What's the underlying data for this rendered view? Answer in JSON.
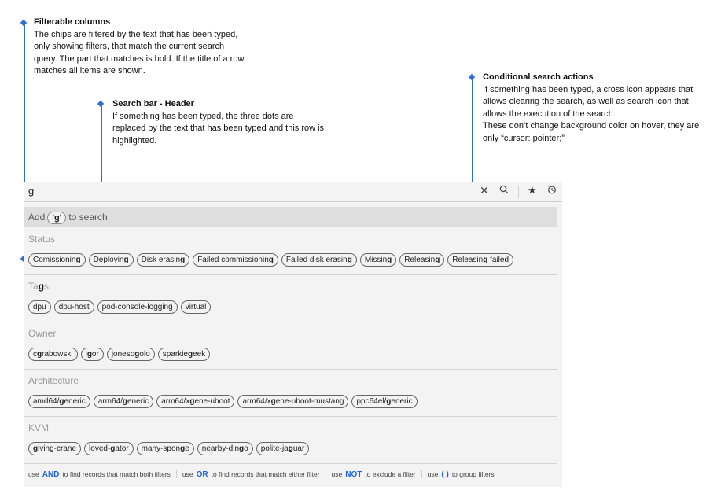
{
  "annotations": {
    "filterable": {
      "title": "Filterable columns",
      "lines": [
        "The chips are filtered by the text that has been typed,",
        "only showing filters, that match the current search",
        "query. The part that matches is bold. If the title of a row",
        "matches all items are shown."
      ]
    },
    "searchbar": {
      "title": "Search bar - Header",
      "lines": [
        "If something has been typed, the three dots are",
        "replaced by the text that has been typed and this row is",
        "highlighted."
      ]
    },
    "conditional": {
      "title": "Conditional search actions",
      "lines": [
        "If something has been typed, a cross icon appears that",
        "allows clearing the search, as well as search icon that",
        "allows the execution of the search.",
        "These don’t change background color on hover, they are",
        "only “cursor: pointer;”"
      ]
    }
  },
  "search": {
    "query": "g",
    "icons": [
      "close-icon",
      "search-icon",
      "star-icon",
      "history-icon"
    ]
  },
  "add_row": {
    "prefix": "Add",
    "chip": "'g'",
    "suffix": "to search"
  },
  "sections": [
    {
      "title_parts": [
        "Status"
      ],
      "chips": [
        [
          "Comissionin",
          "g",
          ""
        ],
        [
          "Deployin",
          "g",
          ""
        ],
        [
          "Disk erasin",
          "g",
          ""
        ],
        [
          "Failed commissionin",
          "g",
          ""
        ],
        [
          "Failed disk erasin",
          "g",
          ""
        ],
        [
          "Missin",
          "g",
          ""
        ],
        [
          "Releasin",
          "g",
          ""
        ],
        [
          "Releasin",
          "g",
          " failed"
        ]
      ]
    },
    {
      "title_parts": [
        "Ta",
        "g",
        "s"
      ],
      "chips": [
        [
          "dpu",
          "",
          ""
        ],
        [
          "dpu-host",
          "",
          ""
        ],
        [
          "pod-console-logging",
          "",
          ""
        ],
        [
          "virtual",
          "",
          ""
        ]
      ]
    },
    {
      "title_parts": [
        "Owner"
      ],
      "chips": [
        [
          "c",
          "g",
          "rabowski"
        ],
        [
          "i",
          "g",
          "or"
        ],
        [
          "joneso",
          "g",
          "olo"
        ],
        [
          "sparkie",
          "g",
          "eek"
        ]
      ]
    },
    {
      "title_parts": [
        "Architecture"
      ],
      "chips": [
        [
          "amd64/",
          "g",
          "eneric"
        ],
        [
          "arm64/",
          "g",
          "eneric"
        ],
        [
          "arm64/x",
          "g",
          "ene-uboot"
        ],
        [
          "arm64/x",
          "g",
          "ene-uboot-mustang"
        ],
        [
          "ppc64el/",
          "g",
          "eneric"
        ]
      ]
    },
    {
      "title_parts": [
        "KVM"
      ],
      "chips": [
        [
          "",
          "g",
          "iving-crane"
        ],
        [
          "loved-",
          "g",
          "ator"
        ],
        [
          "many-spon",
          "g",
          "e"
        ],
        [
          "nearby-din",
          "g",
          "o"
        ],
        [
          "polite-ja",
          "g",
          "uar"
        ]
      ]
    }
  ],
  "footer": [
    {
      "pre": "use",
      "kw": "AND",
      "post": "to find records that match both filters"
    },
    {
      "pre": "use",
      "kw": "OR",
      "post": "to find records that match either filter"
    },
    {
      "pre": "use",
      "kw": "NOT",
      "post": "to exclude a filter"
    },
    {
      "pre": "use",
      "kw": "( )",
      "post": "to group filters"
    }
  ],
  "colors": {
    "accent": "#2f6fd6",
    "keyword": "#1f62d8",
    "panel_bg": "#f3f3f3",
    "highlight_row": "#dedede"
  }
}
